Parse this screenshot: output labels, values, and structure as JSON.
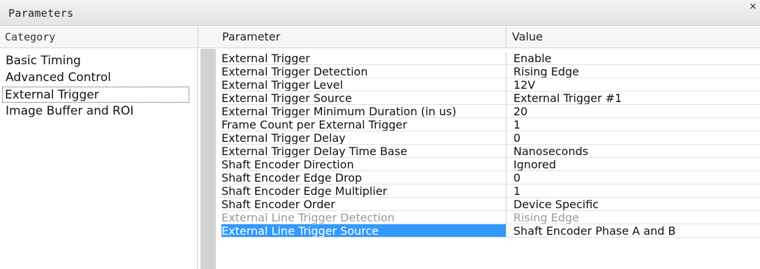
{
  "window": {
    "title": "Parameters",
    "close_glyph": "×"
  },
  "headers": {
    "category": "Category",
    "parameter": "Parameter",
    "value": "Value"
  },
  "categories": [
    {
      "label": "Basic Timing",
      "selected": false
    },
    {
      "label": "Advanced Control",
      "selected": false
    },
    {
      "label": "External Trigger",
      "selected": true
    },
    {
      "label": "Image Buffer and ROI",
      "selected": false
    }
  ],
  "rows": [
    {
      "parameter": "External Trigger",
      "value": "Enable"
    },
    {
      "parameter": "External Trigger Detection",
      "value": "Rising Edge"
    },
    {
      "parameter": "External Trigger Level",
      "value": "12V"
    },
    {
      "parameter": "External Trigger Source",
      "value": "External Trigger #1"
    },
    {
      "parameter": "External Trigger Minimum Duration (in us)",
      "value": "20"
    },
    {
      "parameter": "Frame Count per External Trigger",
      "value": "1"
    },
    {
      "parameter": "External Trigger Delay",
      "value": "0"
    },
    {
      "parameter": "External Trigger Delay Time Base",
      "value": "Nanoseconds"
    },
    {
      "parameter": "Shaft Encoder Direction",
      "value": "Ignored"
    },
    {
      "parameter": "Shaft Encoder Edge Drop",
      "value": "0"
    },
    {
      "parameter": "Shaft Encoder Edge Multiplier",
      "value": "1"
    },
    {
      "parameter": "Shaft Encoder Order",
      "value": "Device Specific"
    },
    {
      "parameter": "External Line Trigger Detection",
      "value": "Rising Edge",
      "disabled": true
    },
    {
      "parameter": "External Line Trigger Source",
      "value": "Shaft Encoder Phase A and B",
      "selected": true
    }
  ],
  "colors": {
    "selection": "#3399ff",
    "disabled_text": "#9a9a9a",
    "gutter": "#d2d2d2"
  }
}
